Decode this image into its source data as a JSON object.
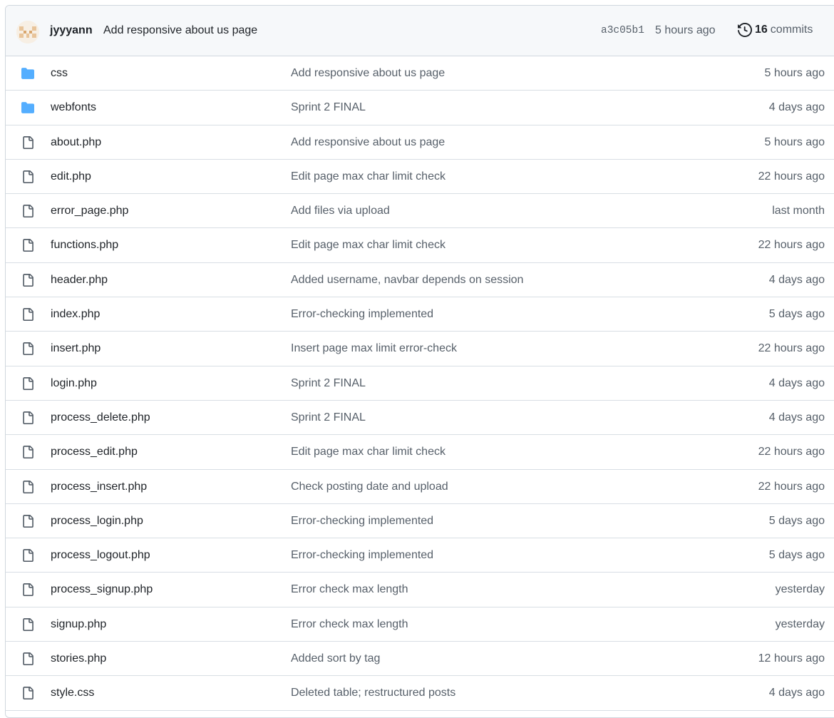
{
  "latest_commit": {
    "author": "jyyyann",
    "message": "Add responsive about us page",
    "sha": "a3c05b1",
    "when": "5 hours ago",
    "commit_count": "16",
    "commit_count_label": "commits"
  },
  "colors": {
    "folder": "#54aeff",
    "file_icon": "#57606a",
    "border": "#d0d7de",
    "header_bg": "#f6f8fa",
    "muted_text": "#57606a"
  },
  "files": [
    {
      "type": "folder",
      "icon": "folder-icon",
      "name": "css",
      "message": "Add responsive about us page",
      "age": "5 hours ago"
    },
    {
      "type": "folder",
      "icon": "folder-icon",
      "name": "webfonts",
      "message": "Sprint 2 FINAL",
      "age": "4 days ago"
    },
    {
      "type": "file",
      "icon": "file-icon",
      "name": "about.php",
      "message": "Add responsive about us page",
      "age": "5 hours ago"
    },
    {
      "type": "file",
      "icon": "file-icon",
      "name": "edit.php",
      "message": "Edit page max char limit check",
      "age": "22 hours ago"
    },
    {
      "type": "file",
      "icon": "file-icon",
      "name": "error_page.php",
      "message": "Add files via upload",
      "age": "last month"
    },
    {
      "type": "file",
      "icon": "file-icon",
      "name": "functions.php",
      "message": "Edit page max char limit check",
      "age": "22 hours ago"
    },
    {
      "type": "file",
      "icon": "file-icon",
      "name": "header.php",
      "message": "Added username, navbar depends on session",
      "age": "4 days ago"
    },
    {
      "type": "file",
      "icon": "file-icon",
      "name": "index.php",
      "message": "Error-checking implemented",
      "age": "5 days ago"
    },
    {
      "type": "file",
      "icon": "file-icon",
      "name": "insert.php",
      "message": "Insert page max limit error-check",
      "age": "22 hours ago"
    },
    {
      "type": "file",
      "icon": "file-icon",
      "name": "login.php",
      "message": "Sprint 2 FINAL",
      "age": "4 days ago"
    },
    {
      "type": "file",
      "icon": "file-icon",
      "name": "process_delete.php",
      "message": "Sprint 2 FINAL",
      "age": "4 days ago"
    },
    {
      "type": "file",
      "icon": "file-icon",
      "name": "process_edit.php",
      "message": "Edit page max char limit check",
      "age": "22 hours ago"
    },
    {
      "type": "file",
      "icon": "file-icon",
      "name": "process_insert.php",
      "message": "Check posting date and upload",
      "age": "22 hours ago"
    },
    {
      "type": "file",
      "icon": "file-icon",
      "name": "process_login.php",
      "message": "Error-checking implemented",
      "age": "5 days ago"
    },
    {
      "type": "file",
      "icon": "file-icon",
      "name": "process_logout.php",
      "message": "Error-checking implemented",
      "age": "5 days ago"
    },
    {
      "type": "file",
      "icon": "file-icon",
      "name": "process_signup.php",
      "message": "Error check max length",
      "age": "yesterday"
    },
    {
      "type": "file",
      "icon": "file-icon",
      "name": "signup.php",
      "message": "Error check max length",
      "age": "yesterday"
    },
    {
      "type": "file",
      "icon": "file-icon",
      "name": "stories.php",
      "message": "Added sort by tag",
      "age": "12 hours ago"
    },
    {
      "type": "file",
      "icon": "file-icon",
      "name": "style.css",
      "message": "Deleted table; restructured posts",
      "age": "4 days ago"
    }
  ]
}
